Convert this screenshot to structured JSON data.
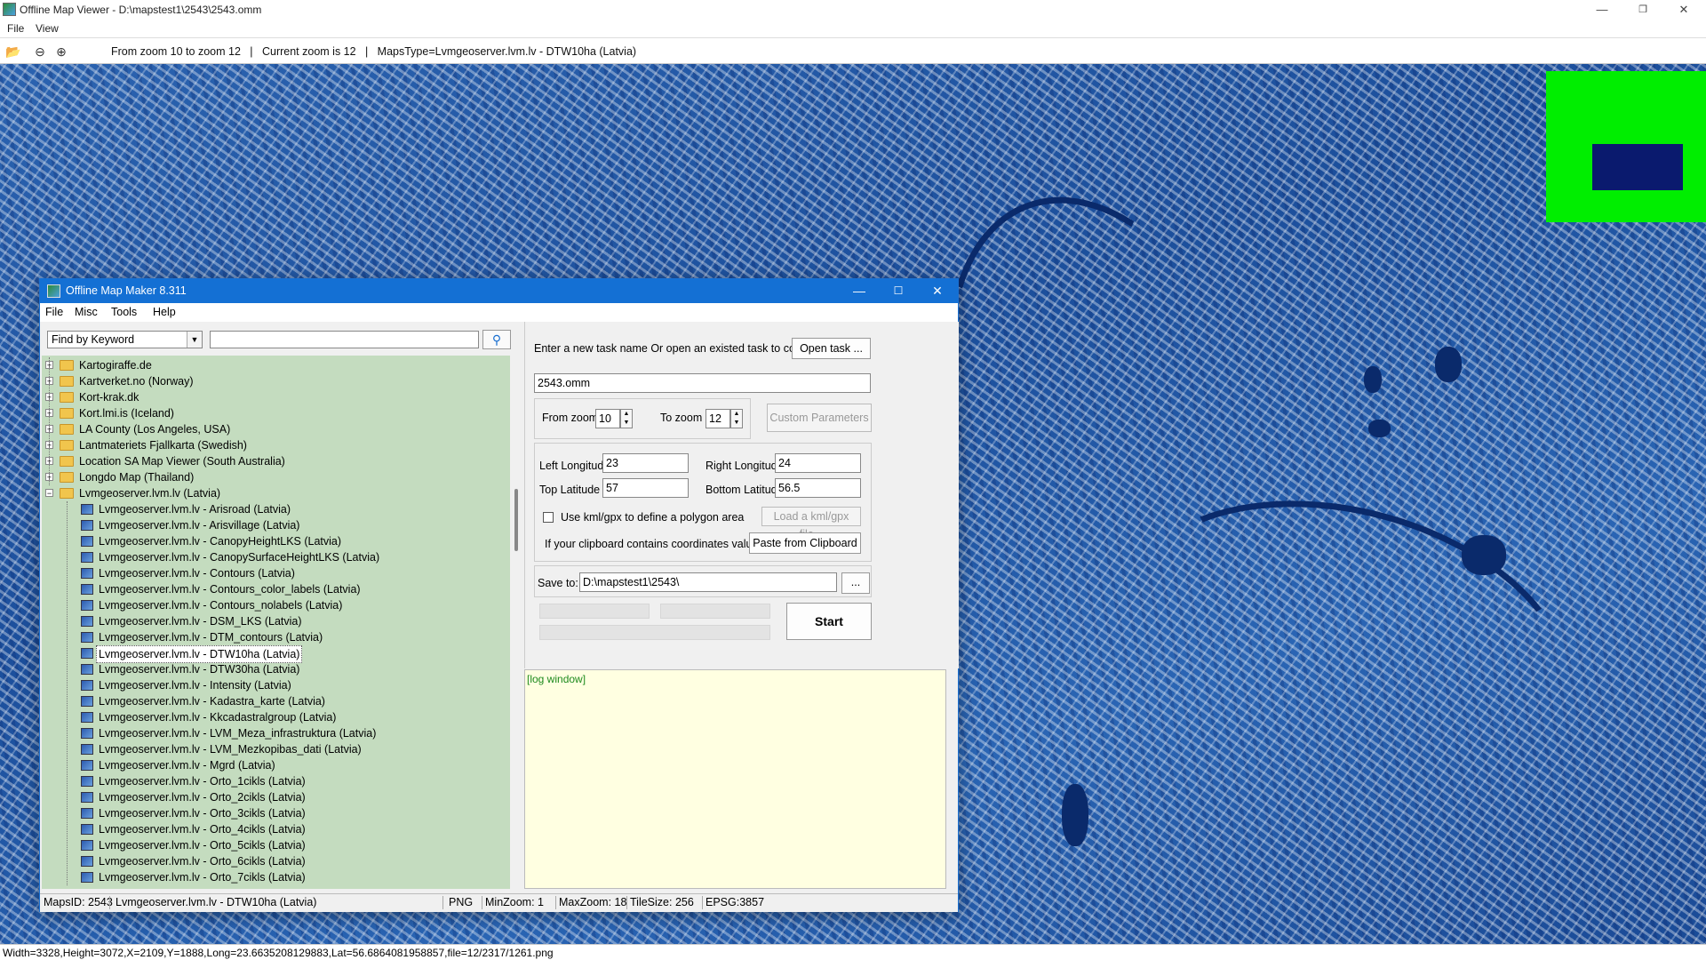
{
  "outer_window": {
    "title": "Offline Map Viewer - D:\\mapstest1\\2543\\2543.omm",
    "menu": [
      "File",
      "View"
    ],
    "toolbar_info": "From zoom 10 to zoom 12   |   Current zoom is 12   |   MapsType=Lvmgeoserver.lvm.lv - DTW10ha (Latvia)",
    "status": "Width=3328,Height=3072,X=2109,Y=1888,Long=23.6635208129883,Lat=56.6864081958857,file=12/2317/1261.png",
    "icons": [
      "open-folder-icon",
      "zoom-out-icon",
      "zoom-in-icon"
    ]
  },
  "minimap": {
    "background": "#00ee00",
    "viewport_color": "#0a1a6e"
  },
  "dialog": {
    "title": "Offline Map Maker 8.311",
    "menu": [
      "File",
      "Misc",
      "Tools",
      "Help"
    ],
    "search": {
      "mode": "Find by Keyword",
      "value": ""
    },
    "tree": {
      "folders": [
        "Kartogiraffe.de",
        "Kartverket.no (Norway)",
        "Kort-krak.dk",
        "Kort.lmi.is (Iceland)",
        "LA County (Los Angeles, USA)",
        "Lantmateriets Fjallkarta (Swedish)",
        "Location SA Map Viewer (South Australia)",
        "Longdo Map (Thailand)"
      ],
      "open_folder": "Lvmgeoserver.lvm.lv (Latvia)",
      "children": [
        "Lvmgeoserver.lvm.lv - Arisroad (Latvia)",
        "Lvmgeoserver.lvm.lv - Arisvillage (Latvia)",
        "Lvmgeoserver.lvm.lv - CanopyHeightLKS (Latvia)",
        "Lvmgeoserver.lvm.lv - CanopySurfaceHeightLKS (Latvia)",
        "Lvmgeoserver.lvm.lv - Contours (Latvia)",
        "Lvmgeoserver.lvm.lv - Contours_color_labels (Latvia)",
        "Lvmgeoserver.lvm.lv - Contours_nolabels (Latvia)",
        "Lvmgeoserver.lvm.lv - DSM_LKS (Latvia)",
        "Lvmgeoserver.lvm.lv - DTM_contours (Latvia)",
        "Lvmgeoserver.lvm.lv - DTW10ha (Latvia)",
        "Lvmgeoserver.lvm.lv - DTW30ha (Latvia)",
        "Lvmgeoserver.lvm.lv - Intensity (Latvia)",
        "Lvmgeoserver.lvm.lv - Kadastra_karte (Latvia)",
        "Lvmgeoserver.lvm.lv - Kkcadastralgroup (Latvia)",
        "Lvmgeoserver.lvm.lv - LVM_Meza_infrastruktura (Latvia)",
        "Lvmgeoserver.lvm.lv - LVM_Mezkopibas_dati (Latvia)",
        "Lvmgeoserver.lvm.lv - Mgrd (Latvia)",
        "Lvmgeoserver.lvm.lv - Orto_1cikls (Latvia)",
        "Lvmgeoserver.lvm.lv - Orto_2cikls (Latvia)",
        "Lvmgeoserver.lvm.lv - Orto_3cikls (Latvia)",
        "Lvmgeoserver.lvm.lv - Orto_4cikls (Latvia)",
        "Lvmgeoserver.lvm.lv - Orto_5cikls (Latvia)",
        "Lvmgeoserver.lvm.lv - Orto_6cikls (Latvia)",
        "Lvmgeoserver.lvm.lv - Orto_7cikls (Latvia)"
      ],
      "selected": "Lvmgeoserver.lvm.lv - DTW10ha (Latvia)"
    },
    "task": {
      "prompt": "Enter a new task name Or open an existed task to continue:",
      "open_button": "Open task ...",
      "name": "2543.omm"
    },
    "zoom": {
      "from_label": "From zoom",
      "from_value": "10",
      "to_label": "To zoom",
      "to_value": "12",
      "custom_button": "Custom Parameters"
    },
    "coords": {
      "left_label": "Left Longitude",
      "left_value": "23",
      "right_label": "Right Longitude",
      "right_value": "24",
      "top_label": "Top Latitude",
      "top_value": "57",
      "bottom_label": "Bottom Latitude",
      "bottom_value": "56.5"
    },
    "polygon": {
      "checkbox_label": "Use kml/gpx to define a polygon area",
      "checked": false,
      "load_button": "Load a kml/gpx file..."
    },
    "clipboard": {
      "label": "If your clipboard contains coordinates values:",
      "button": "Paste from Clipboard"
    },
    "save": {
      "label": "Save to:",
      "path": "D:\\mapstest1\\2543\\",
      "browse": "..."
    },
    "start_button": "Start",
    "log_text": "[log window]",
    "status": {
      "maps_id": "MapsID: 2543",
      "map_name": "Lvmgeoserver.lvm.lv - DTW10ha (Latvia)",
      "format": "PNG",
      "min_zoom": "MinZoom: 1",
      "max_zoom": "MaxZoom: 18",
      "tile_size": "TileSize: 256",
      "epsg": "EPSG:3857"
    }
  }
}
